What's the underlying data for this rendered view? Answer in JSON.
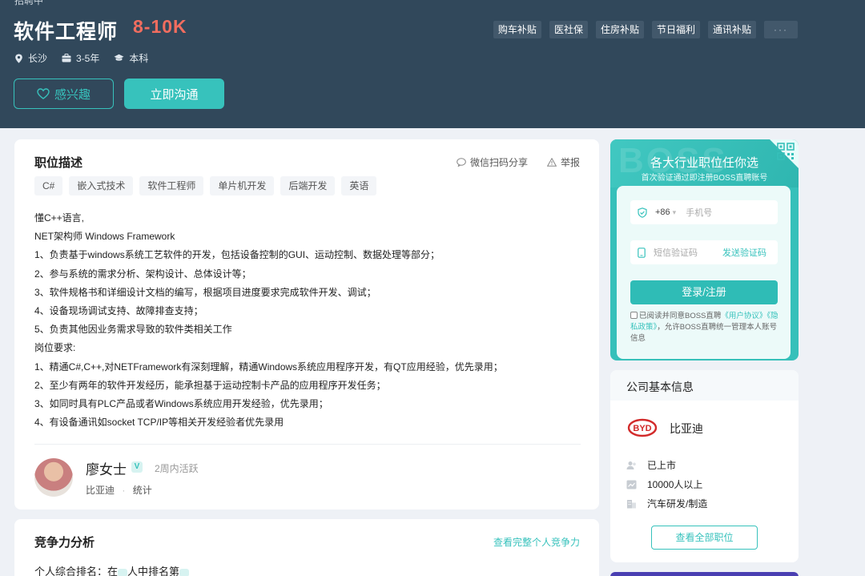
{
  "colors": {
    "header_bg": "#31485b",
    "accent": "#37c2bc",
    "salary": "#f26d5f"
  },
  "header": {
    "breadcrumb": "招聘中",
    "title": "软件工程师",
    "salary": "8-10K",
    "meta": [
      {
        "icon": "location-icon",
        "text": "长沙"
      },
      {
        "icon": "briefcase-icon",
        "text": "3-5年"
      },
      {
        "icon": "graduation-cap-icon",
        "text": "本科"
      }
    ],
    "benefits": [
      "购车补贴",
      "医社保",
      "住房补贴",
      "节日福利",
      "通讯补贴",
      "···"
    ],
    "interest_label": "感兴趣",
    "chat_label": "立即沟通"
  },
  "description": {
    "title": "职位描述",
    "share_label": "微信扫码分享",
    "report_label": "举报",
    "tags": [
      "C#",
      "嵌入式技术",
      "软件工程师",
      "单片机开发",
      "后端开发",
      "英语"
    ],
    "lines": [
      "懂C++语言,",
      "NET架构师   Windows  Framework",
      "1、负责基于windows系统工艺软件的开发，包括设备控制的GUI、运动控制、数据处理等部分；",
      "2、参与系统的需求分析、架构设计、总体设计等；",
      "3、软件规格书和详细设计文档的编写，根据项目进度要求完成软件开发、调试；",
      "4、设备现场调试支持、故障排查支持；",
      "5、负责其他因业务需求导致的软件类相关工作",
      "岗位要求:",
      "1、精通C#,C++,对NETFramework有深刻理解，精通Windows系统应用程序开发，有QT应用经验，优先录用；",
      "2、至少有两年的软件开发经历，能承担基于运动控制卡产品的应用程序开发任务；",
      "3、如同时具有PLC产品或者Windows系统应用开发经验，优先录用；",
      "4、有设备通讯如socket  TCP/IP等相关开发经验者优先录用"
    ]
  },
  "recruiter": {
    "name": "廖女士",
    "verify_badge": "V",
    "active": "2周内活跃",
    "company": "比亚迪",
    "separator": "·",
    "role": "统计"
  },
  "competition": {
    "title": "竞争力分析",
    "link": "查看完整个人竞争力",
    "rank_prefix": "个人综合排名：在",
    "rank_middle": "人中排名第"
  },
  "login": {
    "bg_word": "BOSS",
    "title": "各大行业职位任你选",
    "subtitle": "首次验证通过即注册BOSS直聘账号",
    "country_code": "+86",
    "country_caret": "▾",
    "phone_placeholder": "手机号",
    "code_placeholder": "短信验证码",
    "send_code": "发送验证码",
    "submit": "登录/注册",
    "agree_prefix": "已阅读并同意BOSS直聘",
    "user_agreement": "《用户协议》",
    "privacy_policy": "《隐私政策》",
    "agree_suffix": "，允许BOSS直聘统一管理本人账号信息"
  },
  "company": {
    "section_title": "公司基本信息",
    "logo_text": "BYD",
    "name": "比亚迪",
    "stage": "已上市",
    "size": "10000人以上",
    "industry": "汽车研发/制造",
    "all_jobs": "查看全部职位"
  }
}
